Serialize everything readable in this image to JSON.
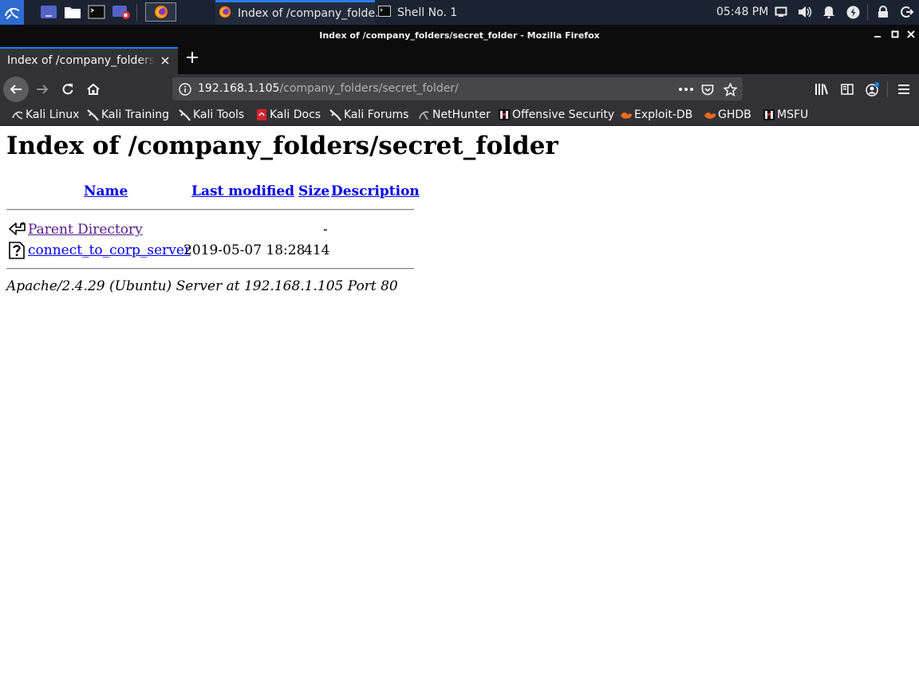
{
  "taskbar": {
    "tasks": [
      {
        "label": "Index of /company_folde...",
        "active": true,
        "icon": "firefox-icon"
      },
      {
        "label": "Shell No. 1",
        "active": false,
        "icon": "terminal-icon"
      }
    ],
    "clock": "05:48 PM"
  },
  "window": {
    "title": "Index of /company_folders/secret_folder - Mozilla Firefox"
  },
  "tabs": [
    {
      "label": "Index of /company_folders/secret_folder",
      "close_icon": "close-icon"
    }
  ],
  "navbar": {
    "url_host": "192.168.1.105",
    "url_path": "/company_folders/secret_folder/"
  },
  "bookmarks": [
    {
      "label": "Kali Linux",
      "icon": "kali-dragon-icon"
    },
    {
      "label": "Kali Training",
      "icon": "kali-dragon-icon"
    },
    {
      "label": "Kali Tools",
      "icon": "kali-dragon-icon"
    },
    {
      "label": "Kali Docs",
      "icon": "kali-docs-icon"
    },
    {
      "label": "Kali Forums",
      "icon": "kali-dragon-icon"
    },
    {
      "label": "NetHunter",
      "icon": "nethunter-icon"
    },
    {
      "label": "Offensive Security",
      "icon": "offsec-icon"
    },
    {
      "label": "Exploit-DB",
      "icon": "exploit-db-icon"
    },
    {
      "label": "GHDB",
      "icon": "exploit-db-icon"
    },
    {
      "label": "MSFU",
      "icon": "offsec-icon"
    }
  ],
  "page": {
    "heading": "Index of /company_folders/secret_folder",
    "columns": {
      "name": "Name",
      "last_modified": "Last modified",
      "size": "Size",
      "description": "Description"
    },
    "rows": [
      {
        "name": "Parent Directory",
        "modified": "",
        "size": "-",
        "icon": "back-arrow-icon",
        "visited": true
      },
      {
        "name": "connect_to_corp_server",
        "modified": "2019-05-07 18:28",
        "size": "414",
        "icon": "unknown-file-icon",
        "visited": false
      }
    ],
    "address": "Apache/2.4.29 (Ubuntu) Server at 192.168.1.105 Port 80"
  },
  "colors": {
    "link": "#0000ee",
    "visited_link": "#551a8b",
    "firefox_accent": "#0a84ff",
    "kali_panel": "#1c2330"
  }
}
